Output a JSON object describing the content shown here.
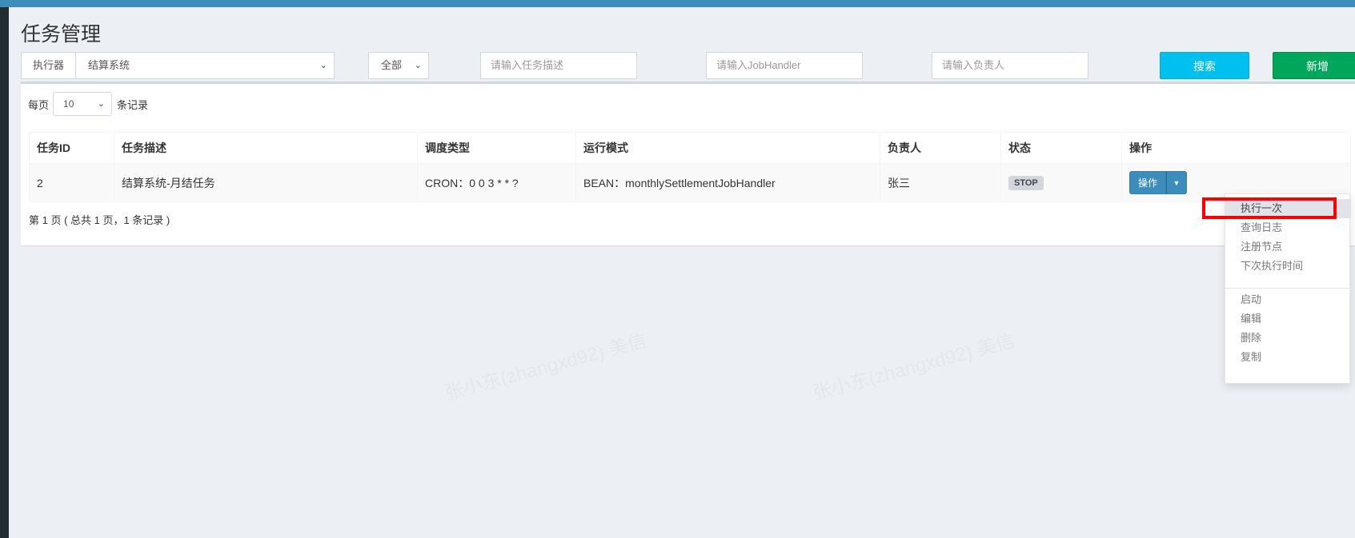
{
  "page": {
    "title": "任务管理"
  },
  "filters": {
    "executor_label": "执行器",
    "executor_value": "结算系统",
    "status_value": "全部",
    "desc_placeholder": "请输入任务描述",
    "handler_placeholder": "请输入JobHandler",
    "author_placeholder": "请输入负责人",
    "search_label": "搜索",
    "add_label": "新增"
  },
  "table_controls": {
    "per_page_prefix": "每页",
    "per_page_value": "10",
    "per_page_suffix": "条记录"
  },
  "table": {
    "headers": [
      "任务ID",
      "任务描述",
      "调度类型",
      "运行模式",
      "负责人",
      "状态",
      "操作"
    ],
    "rows": [
      {
        "id": "2",
        "desc": "结算系统-月结任务",
        "schedule": "CRON：0 0 3 * * ?",
        "mode": "BEAN：monthlySettlementJobHandler",
        "author": "张三",
        "status": "STOP",
        "action_label": "操作"
      }
    ]
  },
  "pagination": {
    "info": "第 1 页 ( 总共 1 页，1 条记录 )"
  },
  "dropdown": {
    "items_top": [
      "执行一次",
      "查询日志",
      "注册节点",
      "下次执行时间"
    ],
    "items_bottom": [
      "启动",
      "编辑",
      "删除",
      "复制"
    ]
  },
  "watermark": {
    "text": "张小东(zhangxd92) 美信"
  },
  "colors": {
    "header": "#3c8dbc",
    "search": "#00c0ef",
    "add": "#00a65a",
    "highlight": "#ff0000"
  }
}
